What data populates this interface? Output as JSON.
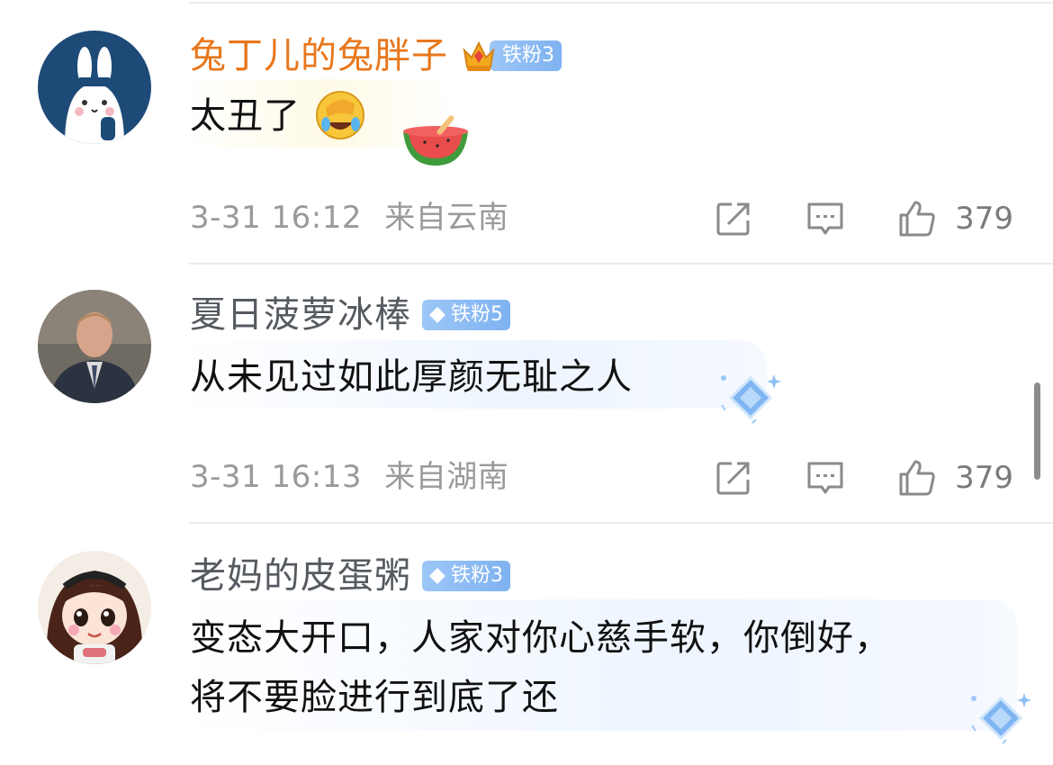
{
  "comments": [
    {
      "username": "兔丁儿的兔胖子",
      "badge": "铁粉3",
      "text": "太丑了",
      "time": "3-31 16:12",
      "location": "来自云南",
      "likes": "379",
      "avatar": "bunny-avatar",
      "emoji": [
        "facepalm-laugh-emoji",
        "watermelon-emoji"
      ]
    },
    {
      "username": "夏日菠萝冰棒",
      "badge": "铁粉5",
      "text": "从未见过如此厚颜无耻之人",
      "time": "3-31 16:13",
      "location": "来自湖南",
      "likes": "379",
      "avatar": "man-in-suit-avatar"
    },
    {
      "username": "老妈的皮蛋粥",
      "badge": "铁粉3",
      "text_line1": "变态大开口，人家对你心慈手软，你倒好，",
      "text_line2": "将不要脸进行到底了还",
      "avatar": "cartoon-girl-avatar"
    }
  ],
  "icons": {
    "share": "share-icon",
    "reply": "reply-icon",
    "like": "thumbs-up-icon",
    "badge_gem": "diamond-icon",
    "crown": "crown-icon"
  },
  "colors": {
    "vip_name": "#e8771c",
    "name": "#555a60",
    "badge": "#8ebcf4",
    "meta": "#9a9a9a"
  }
}
